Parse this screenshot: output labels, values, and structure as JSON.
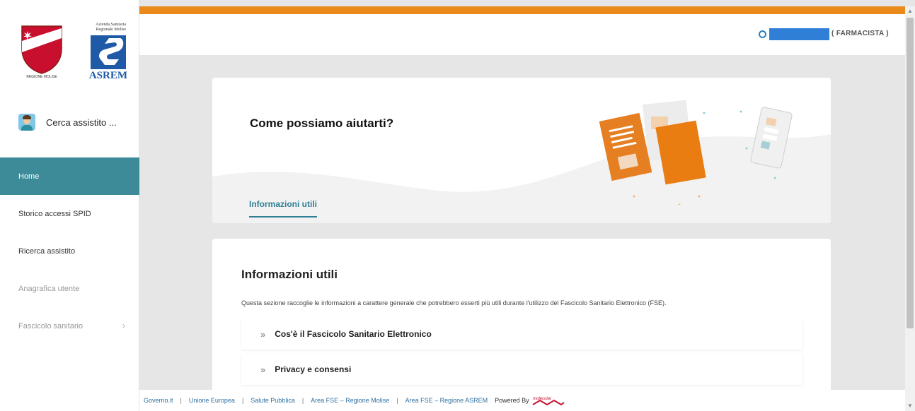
{
  "colors": {
    "accent_orange": "#e98a1a",
    "teal_active": "#3d8b99",
    "link_blue": "#2f6f9f"
  },
  "logos": {
    "molise_text": "REGIONE MOLISE",
    "asrem_top": "Azienda Sanitaria Regionale Molise",
    "asrem_name": "ASREM"
  },
  "sidebar": {
    "search_label": "Cerca assistito ...",
    "items": [
      {
        "label": "Home",
        "active": true
      },
      {
        "label": "Storico accessi SPID"
      },
      {
        "label": "Ricerca assistito"
      },
      {
        "label": "Anagrafica utente",
        "disabled": true
      },
      {
        "label": "Fascicolo sanitario",
        "disabled": true,
        "icon": "chevron-right-icon"
      }
    ]
  },
  "header": {
    "role": "( FARMACISTA )"
  },
  "hero": {
    "title": "Come possiamo aiutarti?",
    "tab": "Informazioni utili"
  },
  "info": {
    "title": "Informazioni utili",
    "description": "Questa sezione raccoglie le informazioni a carattere generale che potrebbero esserti più utili durante l'utilizzo del Fascicolo Sanitario Elettronico (FSE).",
    "accordion": [
      {
        "label": "Cos'è il Fascicolo Sanitario Elettronico",
        "icon": "double-chevron-right-icon"
      },
      {
        "label": "Privacy e consensi",
        "icon": "double-chevron-right-icon"
      }
    ]
  },
  "footer": {
    "links": [
      "Governo.it",
      "Unione Europea",
      "Salute Pubblica",
      "Area FSE – Regione Molise",
      "Area FSE – Regione ASREM"
    ],
    "separator": "|",
    "powered_by": "Powered By",
    "powered_logo_text": "molecolat"
  }
}
